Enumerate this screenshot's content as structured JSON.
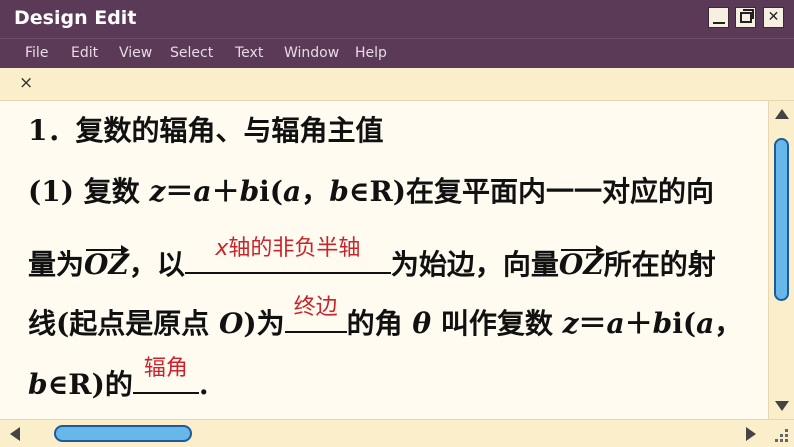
{
  "window": {
    "title": "Design Edit"
  },
  "menu": [
    "File",
    "Edit",
    "View",
    "Select",
    "Text",
    "Window",
    "Help"
  ],
  "tab": {
    "close_glyph": "×"
  },
  "content": {
    "line1": "1．复数的辐角、与辐角主值",
    "line2": {
      "prefix": "(1)  复数 ",
      "z": "z",
      "eq": "＝",
      "a": "a",
      "plus": "＋",
      "b": "b",
      "i": "i(",
      "a2": "a",
      "comma": "，",
      "b2": "b",
      "in": "∈R)在复平面内一一对应的向"
    },
    "line3": {
      "t1": "量为",
      "vec": "OZ",
      "t2": "，以",
      "answer_x": "x",
      "answer_rest": "轴的非负半轴",
      "t3": "为始边，向量",
      "vec2": "OZ",
      "t4": "所在的射"
    },
    "line4": {
      "t1": "线(起点是原点 ",
      "O": "O",
      "t2": ")为",
      "answer": "终边",
      "t3": "的角 ",
      "theta": "θ",
      "t4": " 叫作复数 ",
      "z": "z",
      "eq": "＝",
      "a": "a",
      "plus": "＋",
      "b": "b",
      "i": "i(",
      "a2": "a",
      "comma": "，"
    },
    "line5": {
      "b": "b",
      "t1": "∈R)的",
      "answer": "辐角",
      "t2": "."
    }
  },
  "colors": {
    "titlebar": "#5b3a57",
    "answer": "#c9242b",
    "scroll_thumb": "#67b7ea"
  },
  "icons": [
    "minimize-icon",
    "maximize-icon",
    "close-icon",
    "tab-close-icon",
    "scroll-up-icon",
    "scroll-down-icon",
    "scroll-left-icon",
    "scroll-right-icon",
    "resize-grip-icon"
  ]
}
